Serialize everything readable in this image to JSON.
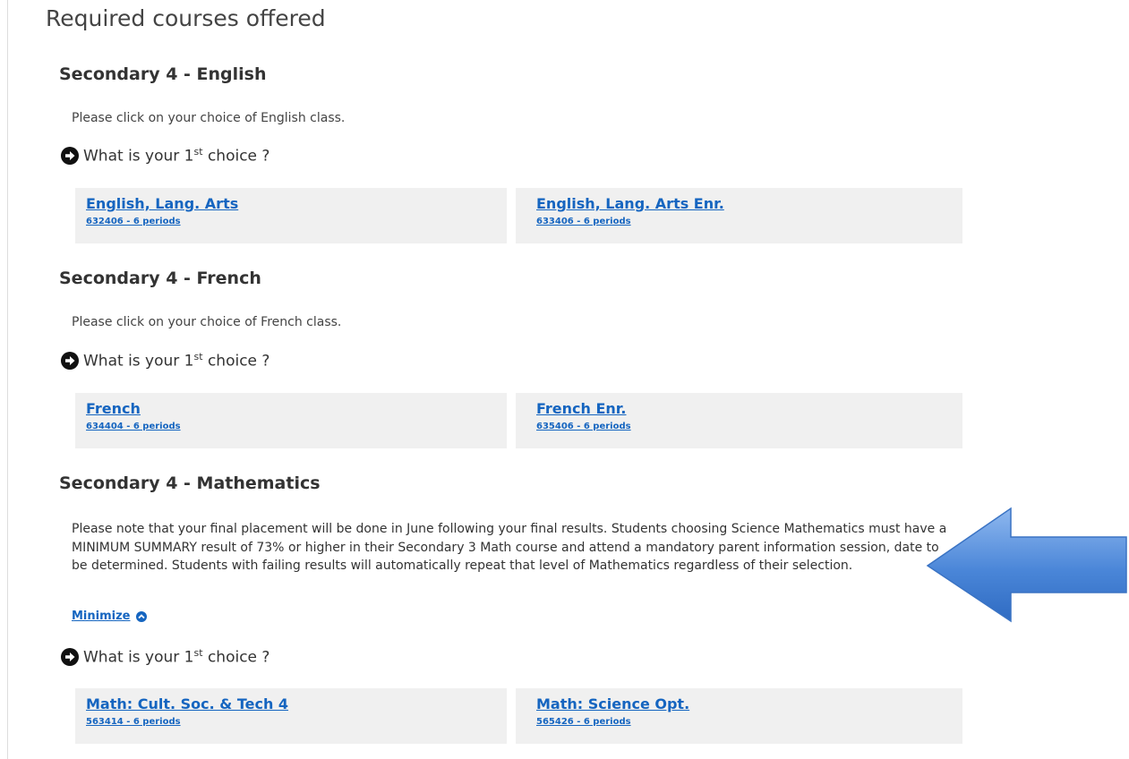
{
  "page": {
    "title": "Required courses offered"
  },
  "question": {
    "prefix": "What is your 1",
    "sup": "st",
    "suffix": " choice ?"
  },
  "sections": [
    {
      "title": "Secondary 4 - English",
      "instruction": "Please click on your choice of English class.",
      "courses": [
        {
          "name": "English, Lang. Arts",
          "code": "632406 - 6 periods"
        },
        {
          "name": "English, Lang. Arts Enr.",
          "code": "633406 - 6 periods"
        }
      ]
    },
    {
      "title": "Secondary 4 - French",
      "instruction": "Please click on your choice of French class.",
      "courses": [
        {
          "name": "French",
          "code": "634404 - 6 periods"
        },
        {
          "name": "French Enr.",
          "code": "635406 - 6 periods"
        }
      ]
    },
    {
      "title": "Secondary 4 - Mathematics",
      "note": "Please note that your final placement will be done in June following your final results. Students choosing Science Mathematics must have a MINIMUM SUMMARY result of 73% or higher in their Secondary 3 Math course and attend a mandatory parent information session, date to be determined. Students with failing results will automatically repeat that level of Mathematics regardless of their selection.",
      "minimize_label": "Minimize",
      "courses": [
        {
          "name": "Math: Cult. Soc. & Tech 4",
          "code": "563414 - 6 periods"
        },
        {
          "name": "Math: Science Opt.",
          "code": "565426 - 6 periods"
        }
      ]
    }
  ],
  "colors": {
    "link": "#1565c0",
    "card_bg": "#f0f0f0",
    "arrow": "#3f7ed6"
  },
  "icons": {
    "question_bullet": "circle-arrow-right-icon",
    "minimize": "chevron-up-circle-icon",
    "callout": "left-arrow-callout"
  }
}
